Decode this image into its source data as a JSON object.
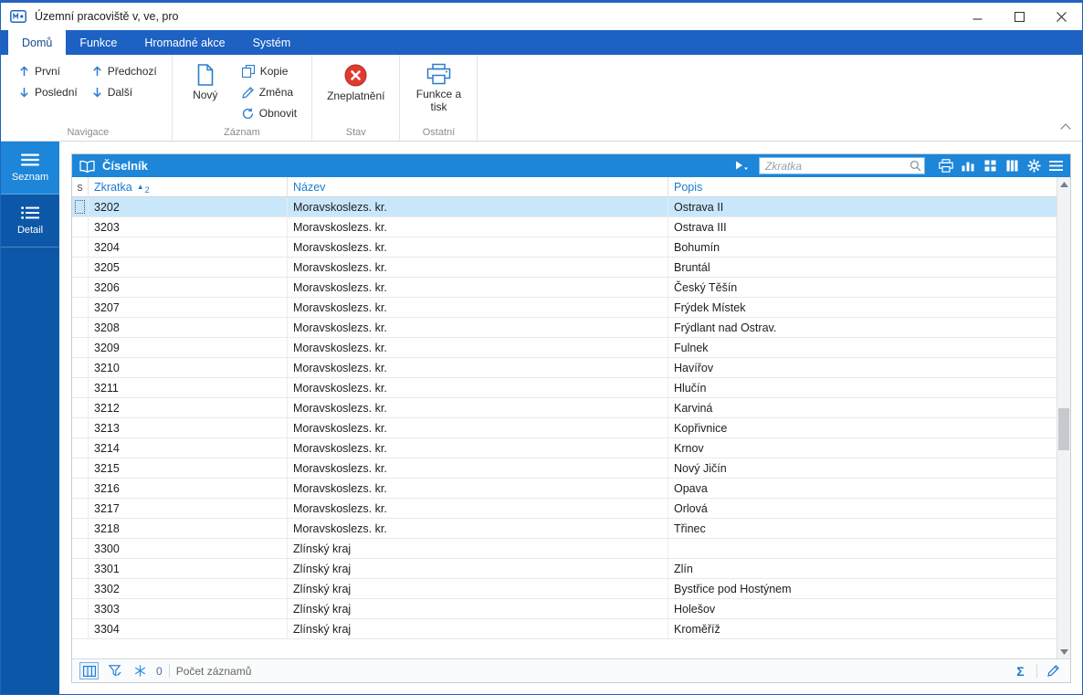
{
  "window": {
    "title": "Územní pracoviště v, ve, pro"
  },
  "ribbon": {
    "tabs": [
      {
        "label": "Domů"
      },
      {
        "label": "Funkce"
      },
      {
        "label": "Hromadné akce"
      },
      {
        "label": "Systém"
      }
    ],
    "navigace": {
      "label": "Navigace",
      "first": "První",
      "last": "Poslední",
      "previous": "Předchozí",
      "next": "Další"
    },
    "zaznam": {
      "label": "Záznam",
      "new": "Nový",
      "copy": "Kopie",
      "change": "Změna",
      "refresh": "Obnovit"
    },
    "stav": {
      "label": "Stav",
      "invalidate": "Zneplatnění"
    },
    "ostatni": {
      "label": "Ostatní",
      "functions_print": "Funkce a tisk"
    }
  },
  "sidebar": {
    "items": [
      {
        "label": "Seznam"
      },
      {
        "label": "Detail"
      }
    ]
  },
  "panel": {
    "title": "Číselník",
    "search_placeholder": "Zkratka"
  },
  "table": {
    "columns": {
      "s": "s",
      "zkratka": "Zkratka",
      "nazev": "Název",
      "popis": "Popis"
    },
    "sort": {
      "glyph": "▲",
      "order": "2"
    },
    "rows": [
      {
        "zkratka": "3202",
        "nazev": "Moravskoslezs. kr.",
        "popis": "Ostrava II",
        "selected": true
      },
      {
        "zkratka": "3203",
        "nazev": "Moravskoslezs. kr.",
        "popis": "Ostrava III"
      },
      {
        "zkratka": "3204",
        "nazev": "Moravskoslezs. kr.",
        "popis": "Bohumín"
      },
      {
        "zkratka": "3205",
        "nazev": "Moravskoslezs. kr.",
        "popis": "Bruntál"
      },
      {
        "zkratka": "3206",
        "nazev": "Moravskoslezs. kr.",
        "popis": "Český Těšín"
      },
      {
        "zkratka": "3207",
        "nazev": "Moravskoslezs. kr.",
        "popis": "Frýdek Místek"
      },
      {
        "zkratka": "3208",
        "nazev": "Moravskoslezs. kr.",
        "popis": "Frýdlant nad Ostrav."
      },
      {
        "zkratka": "3209",
        "nazev": "Moravskoslezs. kr.",
        "popis": "Fulnek"
      },
      {
        "zkratka": "3210",
        "nazev": "Moravskoslezs. kr.",
        "popis": "Havířov"
      },
      {
        "zkratka": "3211",
        "nazev": "Moravskoslezs. kr.",
        "popis": "Hlučín"
      },
      {
        "zkratka": "3212",
        "nazev": "Moravskoslezs. kr.",
        "popis": "Karviná"
      },
      {
        "zkratka": "3213",
        "nazev": "Moravskoslezs. kr.",
        "popis": "Kopřivnice"
      },
      {
        "zkratka": "3214",
        "nazev": "Moravskoslezs. kr.",
        "popis": "Krnov"
      },
      {
        "zkratka": "3215",
        "nazev": "Moravskoslezs. kr.",
        "popis": "Nový Jičín"
      },
      {
        "zkratka": "3216",
        "nazev": "Moravskoslezs. kr.",
        "popis": "Opava"
      },
      {
        "zkratka": "3217",
        "nazev": "Moravskoslezs. kr.",
        "popis": "Orlová"
      },
      {
        "zkratka": "3218",
        "nazev": "Moravskoslezs. kr.",
        "popis": "Třinec"
      },
      {
        "zkratka": "3300",
        "nazev": "Zlínský kraj",
        "popis": ""
      },
      {
        "zkratka": "3301",
        "nazev": "Zlínský kraj",
        "popis": "Zlín"
      },
      {
        "zkratka": "3302",
        "nazev": "Zlínský kraj",
        "popis": "Bystřice pod Hostýnem"
      },
      {
        "zkratka": "3303",
        "nazev": "Zlínský kraj",
        "popis": "Holešov"
      },
      {
        "zkratka": "3304",
        "nazev": "Zlínský kraj",
        "popis": "Kroměříž"
      }
    ]
  },
  "statusbar": {
    "count": "0",
    "count_label": "Počet záznamů",
    "sum_glyph": "Σ"
  }
}
